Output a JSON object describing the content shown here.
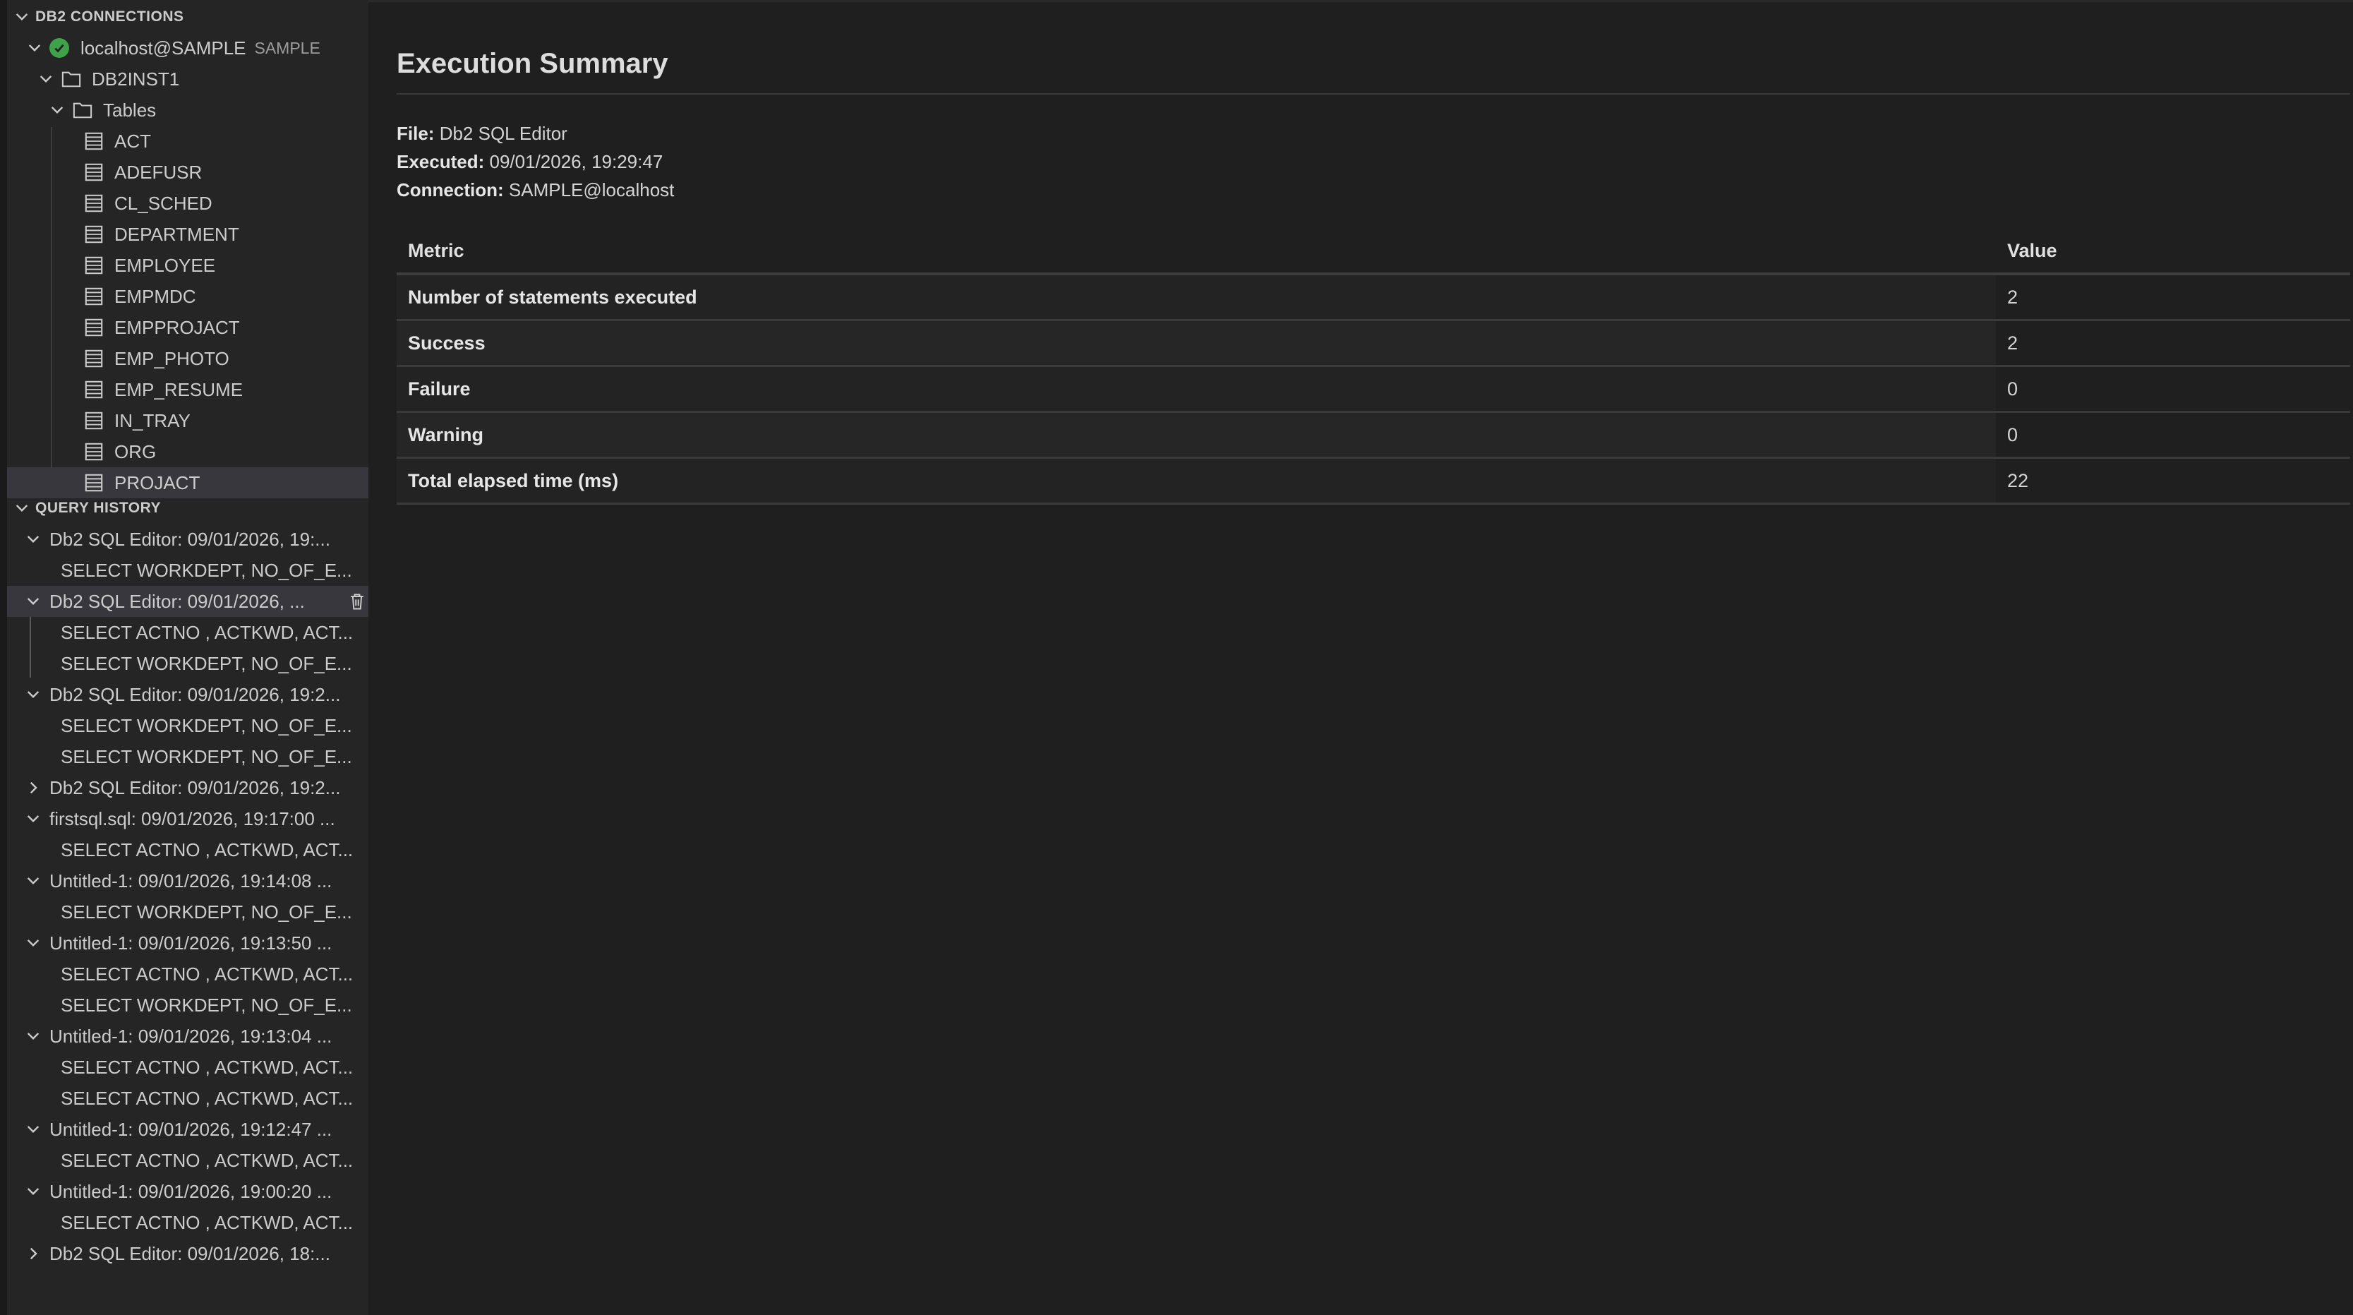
{
  "colors": {
    "background": "#1f1f1f",
    "sidebar": "#252526",
    "selected_row": "#37373d",
    "status_ok": "#3fa14a",
    "text": "#cccccc"
  },
  "sidebar": {
    "connections_header": "DB2 CONNECTIONS",
    "connection": {
      "label": "localhost@SAMPLE",
      "description": "SAMPLE",
      "icon": "check-circle-icon"
    },
    "instance": {
      "label": "DB2INST1",
      "icon": "folder-icon"
    },
    "tables_folder": {
      "label": "Tables",
      "icon": "folder-icon"
    },
    "tables": [
      "ACT",
      "ADEFUSR",
      "CL_SCHED",
      "DEPARTMENT",
      "EMPLOYEE",
      "EMPMDC",
      "EMPPROJACT",
      "EMP_PHOTO",
      "EMP_RESUME",
      "IN_TRAY",
      "ORG",
      "PROJACT"
    ],
    "selected_table": "PROJACT",
    "history_header": "QUERY HISTORY",
    "history": [
      {
        "label": "Db2 SQL Editor: 09/01/2026, 19:...",
        "expanded": true,
        "children": [
          "SELECT WORKDEPT, NO_OF_E..."
        ]
      },
      {
        "label": "Db2 SQL Editor: 09/01/2026, ...",
        "expanded": true,
        "hovered": true,
        "children": [
          "SELECT ACTNO , ACTKWD, ACT...",
          "SELECT WORKDEPT, NO_OF_E..."
        ]
      },
      {
        "label": "Db2 SQL Editor: 09/01/2026, 19:2...",
        "expanded": true,
        "children": [
          "SELECT WORKDEPT, NO_OF_E...",
          "SELECT WORKDEPT, NO_OF_E..."
        ]
      },
      {
        "label": "Db2 SQL Editor: 09/01/2026, 19:2...",
        "expanded": false,
        "children": []
      },
      {
        "label": "firstsql.sql: 09/01/2026, 19:17:00 ...",
        "expanded": true,
        "children": [
          "SELECT ACTNO , ACTKWD, ACT..."
        ]
      },
      {
        "label": "Untitled-1: 09/01/2026, 19:14:08 ...",
        "expanded": true,
        "children": [
          "SELECT WORKDEPT, NO_OF_E..."
        ]
      },
      {
        "label": "Untitled-1: 09/01/2026, 19:13:50 ...",
        "expanded": true,
        "children": [
          "SELECT ACTNO , ACTKWD, ACT...",
          "SELECT WORKDEPT, NO_OF_E..."
        ]
      },
      {
        "label": "Untitled-1: 09/01/2026, 19:13:04 ...",
        "expanded": true,
        "children": [
          "SELECT ACTNO , ACTKWD, ACT...",
          "SELECT ACTNO , ACTKWD, ACT..."
        ]
      },
      {
        "label": "Untitled-1: 09/01/2026, 19:12:47 ...",
        "expanded": true,
        "children": [
          "SELECT ACTNO , ACTKWD, ACT..."
        ]
      },
      {
        "label": "Untitled-1: 09/01/2026, 19:00:20 ...",
        "expanded": true,
        "children": [
          "SELECT ACTNO , ACTKWD, ACT..."
        ]
      },
      {
        "label": "Db2 SQL Editor: 09/01/2026, 18:...",
        "expanded": false,
        "children": []
      }
    ],
    "history_item_action_icon": "trash-icon"
  },
  "summary": {
    "title": "Execution Summary",
    "file_label": "File:",
    "file_value": "Db2 SQL Editor",
    "executed_label": "Executed:",
    "executed_value": "09/01/2026, 19:29:47",
    "connection_label": "Connection:",
    "connection_value": "SAMPLE@localhost",
    "table": {
      "headers": [
        "Metric",
        "Value"
      ],
      "rows": [
        [
          "Number of statements executed",
          "2"
        ],
        [
          "Success",
          "2"
        ],
        [
          "Failure",
          "0"
        ],
        [
          "Warning",
          "0"
        ],
        [
          "Total elapsed time (ms)",
          "22"
        ]
      ]
    }
  }
}
